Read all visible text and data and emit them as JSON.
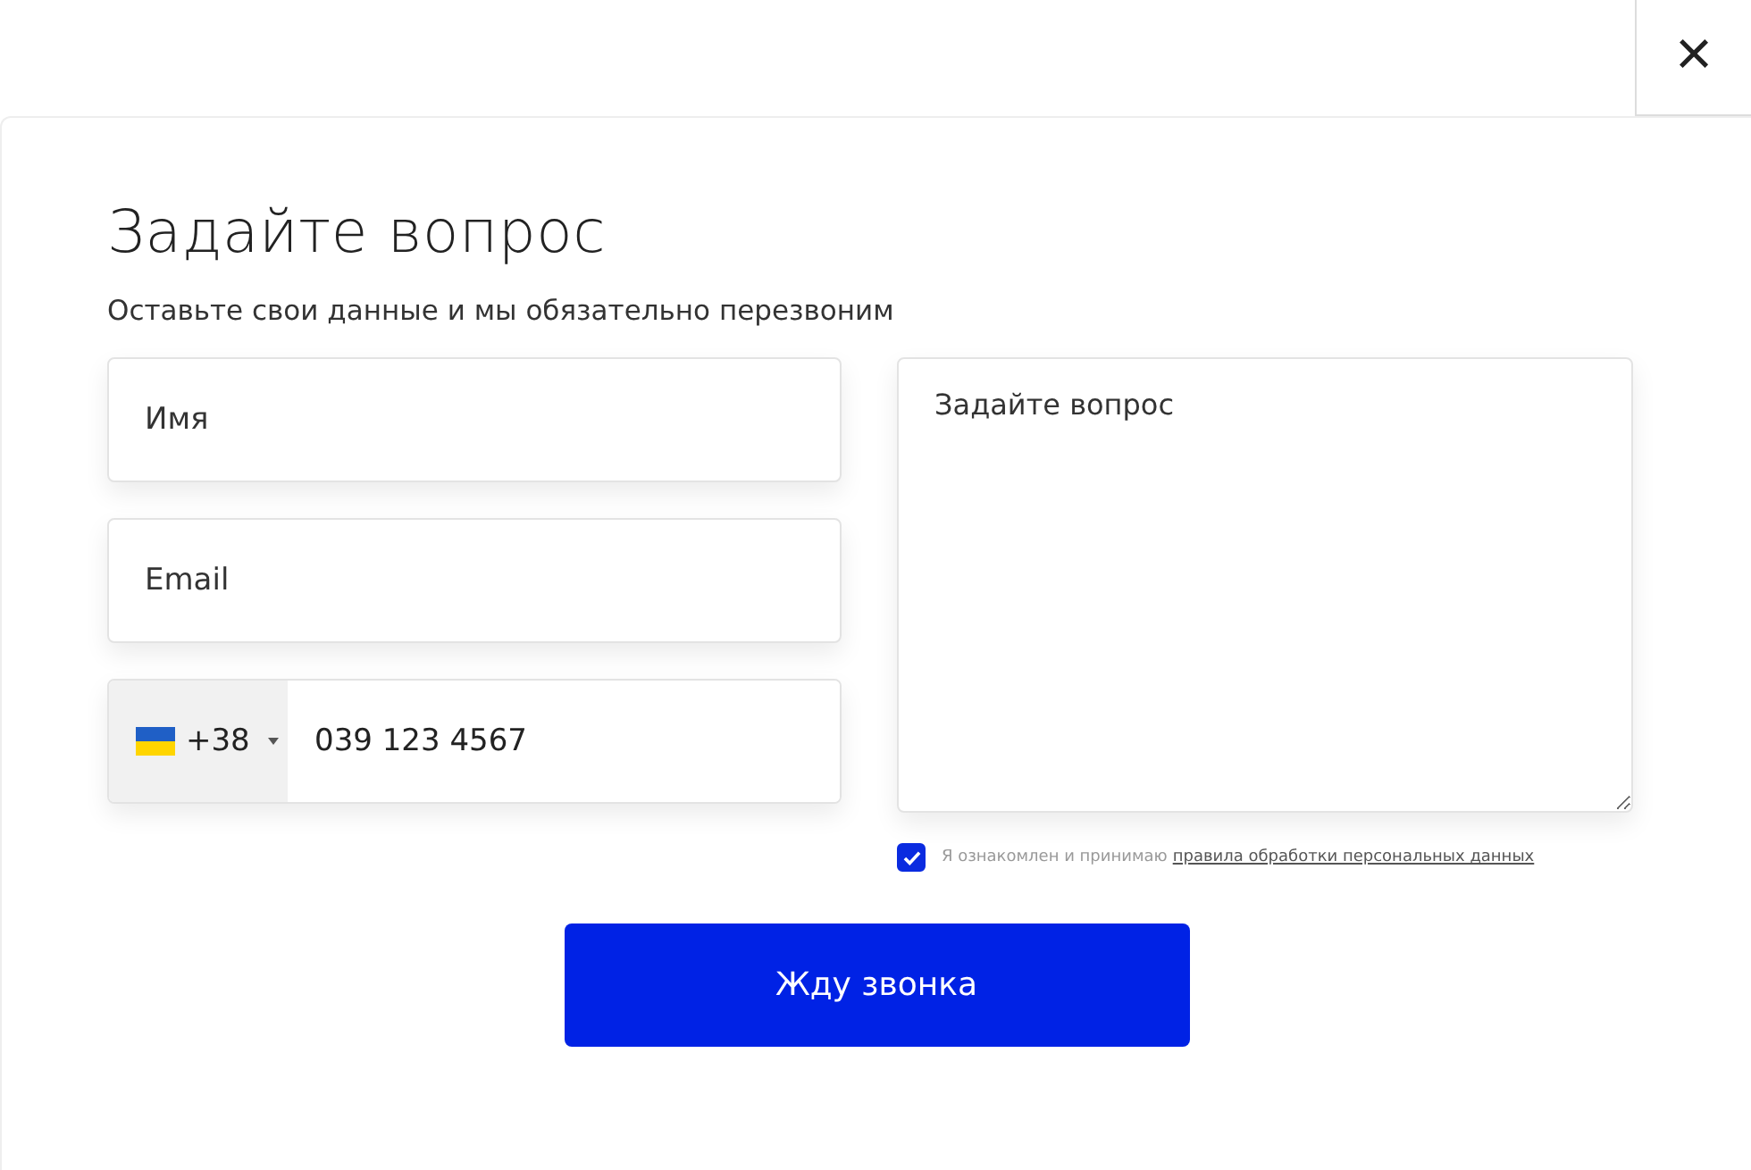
{
  "close_button": {
    "label": "×"
  },
  "form": {
    "title": "Задайте вопрос",
    "subtitle": "Оставьте свои данные и мы обязательно перезвоним",
    "name_field": {
      "placeholder": "Имя"
    },
    "email_field": {
      "placeholder": "Email"
    },
    "phone_field": {
      "country_code": "+38",
      "value": "039 123 4567"
    },
    "question_field": {
      "placeholder": "Задайте вопрос"
    },
    "consent": {
      "checked": true,
      "text": "Я ознакомлен и принимаю",
      "link": "правила обработки персональных данных"
    },
    "submit_button": {
      "label": "Жду звонка"
    }
  }
}
